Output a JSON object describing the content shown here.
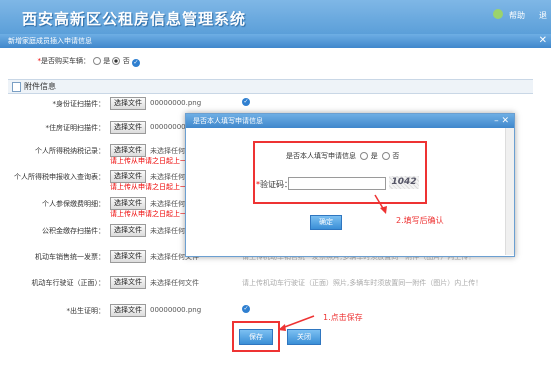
{
  "system": {
    "title": "西安高新区公租房信息管理系统",
    "help": "帮助",
    "exit": "退"
  },
  "dialog": {
    "title": "新增家庭成员插入申请信息",
    "car": {
      "label": "*是否购买车辆：",
      "opt_no_sel": "是",
      "opt_yes_sel": "否"
    },
    "section_title": "附件信息",
    "rows": [
      {
        "label": "*身份证扫描件：",
        "button": "选择文件",
        "file": "00000000.png",
        "check": true
      },
      {
        "label": "*住房证明扫描件：",
        "button": "选择文件",
        "file": "00000000.png",
        "check": true
      },
      {
        "label": "个人所得税纳税记录：",
        "button": "选择文件",
        "file": "未选择任何",
        "warn": "请上传从申请之日起上一"
      },
      {
        "label": "个人所得税申报收入查询表：",
        "button": "选择文件",
        "file": "未选择任何",
        "warn": "请上传从申请之日起上一"
      },
      {
        "label": "个人参保缴费明细：",
        "button": "选择文件",
        "file": "未选择任何",
        "warn": "请上传从申请之日起上一"
      },
      {
        "label": "公积金缴存扫描件：",
        "button": "选择文件",
        "file": "未选择任何"
      },
      {
        "label": "机动车销售统一发票：",
        "button": "选择文件",
        "file": "未选择任何文件",
        "hint": "请上传机动车销售统一发票照片,多辆车时须放置同一附件（图片）内上传！"
      },
      {
        "label": "机动车行驶证（正面）：",
        "button": "选择文件",
        "file": "未选择任何文件",
        "hint": "请上传机动车行驶证（正面）照片,多辆车时须放置同一附件（图片）内上传！"
      },
      {
        "label": "*出生证明：",
        "button": "选择文件",
        "file": "00000000.png",
        "check": true
      }
    ],
    "save": "保存",
    "close": "关闭"
  },
  "modal": {
    "title": "是否本人填写申请信息",
    "question": "是否本人填写申请信息",
    "opt_yes": "是",
    "opt_no": "否",
    "vc_label": "*验证码：",
    "vc_value": "",
    "captcha": "1042",
    "ok": "确定"
  },
  "annotations": {
    "step1": "1.点击保存",
    "step2": "2.填写后确认"
  },
  "colors": {
    "accent": "#3f87cc",
    "annotation": "#ee3333"
  }
}
